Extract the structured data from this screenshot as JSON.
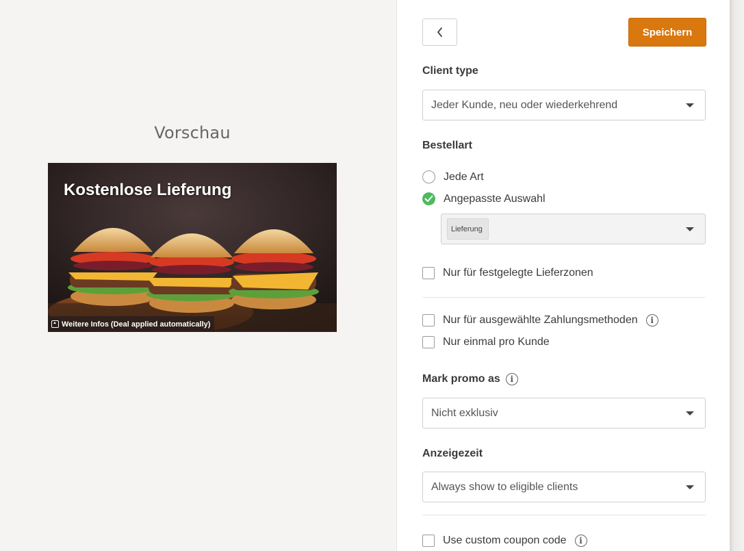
{
  "preview": {
    "heading": "Vorschau",
    "promo_title": "Kostenlose Lieferung",
    "more_info": "Weitere Infos (Deal applied automatically)"
  },
  "toolbar": {
    "back_icon": "chevron-left-icon",
    "save_label": "Speichern",
    "save_color": "#d9780e"
  },
  "client_type": {
    "label": "Client type",
    "value": "Jeder Kunde, neu oder wiederkehrend"
  },
  "order_type": {
    "label": "Bestellart",
    "options": [
      {
        "label": "Jede Art",
        "selected": false
      },
      {
        "label": "Angepasste Auswahl",
        "selected": true
      }
    ],
    "selected_chips": [
      "Lieferung"
    ],
    "check_color": "#4cbb5e"
  },
  "delivery_zones": {
    "label": "Nur für festgelegte Lieferzonen",
    "checked": false
  },
  "payment_methods": {
    "label": "Nur für ausgewählte Zahlungsmethoden",
    "checked": false
  },
  "once_per_client": {
    "label": "Nur einmal pro Kunde",
    "checked": false
  },
  "mark_promo": {
    "label": "Mark promo as",
    "value": "Nicht exklusiv"
  },
  "display_time": {
    "label": "Anzeigezeit",
    "value": "Always show to eligible clients"
  },
  "custom_coupon": {
    "label": "Use custom coupon code",
    "checked": false
  }
}
